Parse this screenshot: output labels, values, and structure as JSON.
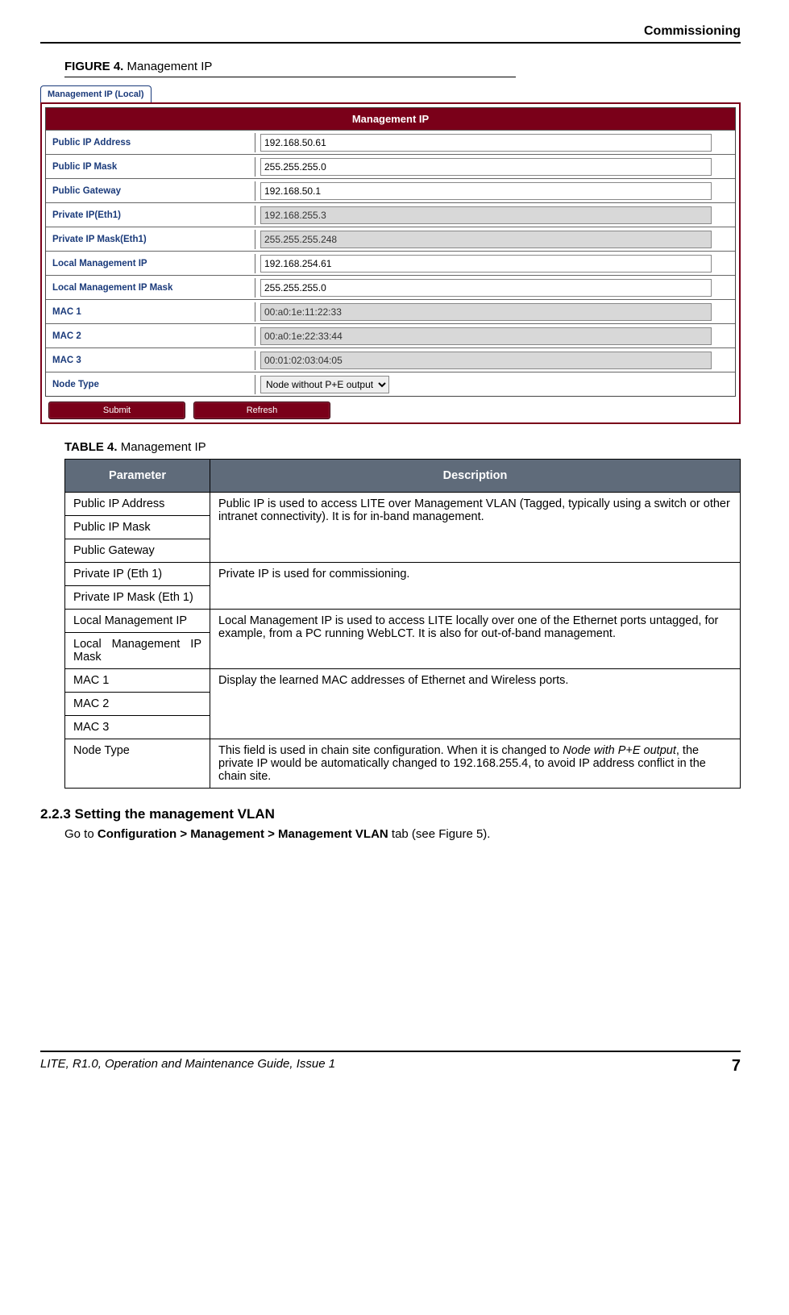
{
  "header": {
    "section": "Commissioning"
  },
  "figure": {
    "prefix": "FIGURE 4.",
    "title": "Management IP"
  },
  "screenshot": {
    "tab": "Management IP (Local)",
    "panel_title": "Management IP",
    "rows": {
      "public_ip_addr": {
        "label": "Public IP Address",
        "value": "192.168.50.61"
      },
      "public_ip_mask": {
        "label": "Public IP Mask",
        "value": "255.255.255.0"
      },
      "public_gateway": {
        "label": "Public Gateway",
        "value": "192.168.50.1"
      },
      "private_ip_eth1": {
        "label": "Private IP(Eth1)",
        "value": "192.168.255.3"
      },
      "private_ip_mask_eth1": {
        "label": "Private IP Mask(Eth1)",
        "value": "255.255.255.248"
      },
      "local_mgmt_ip": {
        "label": "Local Management IP",
        "value": "192.168.254.61"
      },
      "local_mgmt_ip_mask": {
        "label": "Local Management IP Mask",
        "value": "255.255.255.0"
      },
      "mac1": {
        "label": "MAC 1",
        "value": "00:a0:1e:11:22:33"
      },
      "mac2": {
        "label": "MAC 2",
        "value": "00:a0:1e:22:33:44"
      },
      "mac3": {
        "label": "MAC 3",
        "value": "00:01:02:03:04:05"
      },
      "node_type": {
        "label": "Node Type",
        "value": "Node without P+E output"
      }
    },
    "buttons": {
      "submit": "Submit",
      "refresh": "Refresh"
    }
  },
  "table4": {
    "prefix": "TABLE 4.",
    "title": "Management IP",
    "headers": {
      "param": "Parameter",
      "desc": "Description"
    },
    "rows": {
      "r1p1": "Public IP Address",
      "r1p2": "Public IP Mask",
      "r1p3": "Public Gateway",
      "r1d": "Public IP is used to access LITE over Management VLAN (Tagged, typically using a switch or other intranet connectivity). It is for in-band management.",
      "r2p1": "Private IP (Eth 1)",
      "r2p2": "Private IP Mask (Eth 1)",
      "r2d": "Private IP is used for commissioning.",
      "r3p1": "Local Management IP",
      "r3p2": "Local Management IP Mask",
      "r3d": "Local Management IP is used to access LITE locally over one of the Ethernet ports untagged, for example, from a PC running WebLCT. It is also for out-of-band management.",
      "r4p1": "MAC 1",
      "r4p2": "MAC 2",
      "r4p3": "MAC 3",
      "r4d": "Display the learned MAC addresses of Ethernet and Wireless ports.",
      "r5p": "Node Type",
      "r5d_pre": "This field is used in chain site configuration. When it is changed to ",
      "r5d_em": "Node with P+E output",
      "r5d_post": ", the private IP would be automatically changed to 192.168.255.4, to avoid IP address conflict in the chain site."
    }
  },
  "section": {
    "heading": "2.2.3 Setting the management VLAN",
    "para_pre": "Go to ",
    "para_bold": "Configuration > Management > Management VLAN",
    "para_post": " tab (see Figure 5)."
  },
  "footer": {
    "left": "LITE, R1.0, Operation and Maintenance Guide, Issue 1",
    "right": "7"
  }
}
